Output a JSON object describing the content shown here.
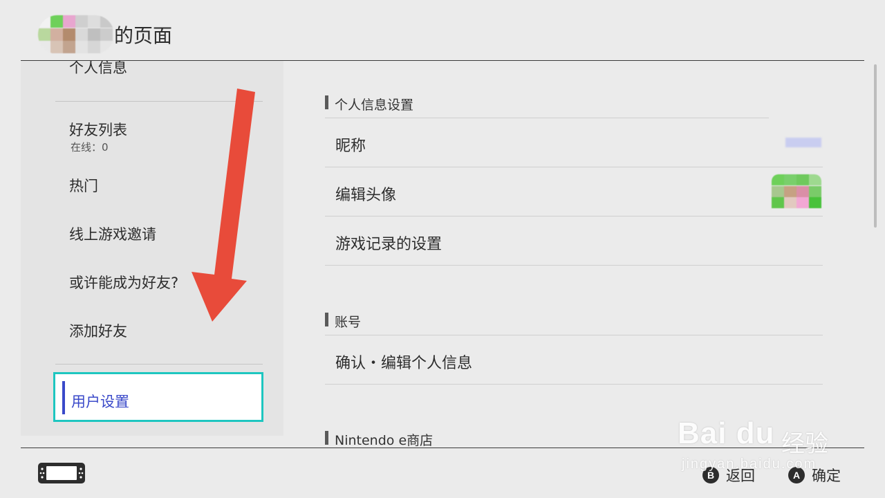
{
  "header": {
    "title": "的页面"
  },
  "sidebar": {
    "items": [
      {
        "label": "个人信息"
      },
      {
        "label": "好友列表",
        "sub": "在线：0"
      },
      {
        "label": "热门"
      },
      {
        "label": "线上游戏邀请"
      },
      {
        "label": "或许能成为好友?"
      },
      {
        "label": "添加好友"
      }
    ],
    "selected": {
      "label": "用户设置"
    }
  },
  "content": {
    "sections": [
      {
        "title": "个人信息设置",
        "rows": [
          {
            "label": "昵称"
          },
          {
            "label": "编辑头像"
          },
          {
            "label": "游戏记录的设置"
          }
        ]
      },
      {
        "title": "账号",
        "rows": [
          {
            "label": "确认・编辑个人信息"
          }
        ]
      },
      {
        "title": "Nintendo e商店",
        "rows": []
      }
    ]
  },
  "footer": {
    "back": {
      "button": "B",
      "label": "返回"
    },
    "confirm": {
      "button": "A",
      "label": "确定"
    }
  },
  "watermark": {
    "logo": "Bai du",
    "text": "经验",
    "url": "jingyan.baidu.com"
  },
  "colors": {
    "accent": "#3a49c9",
    "selection_border": "#1ec6c0",
    "annotation_arrow": "#e84b3a"
  }
}
